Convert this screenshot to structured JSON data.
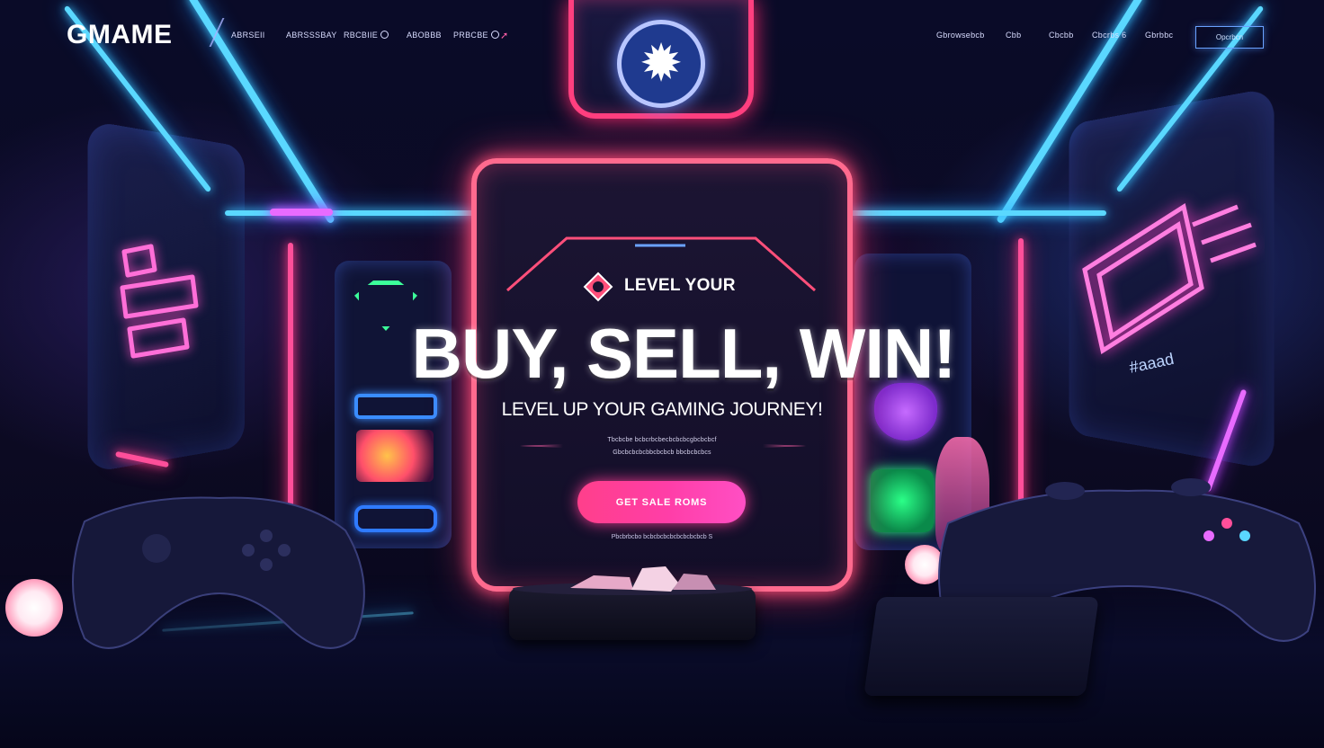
{
  "header": {
    "logo": "GMAME",
    "nav_left": [
      {
        "label": "ABRSEII",
        "icon": ""
      },
      {
        "label": "ABRSSSBAY",
        "icon": ""
      },
      {
        "label": "RBCBIIE",
        "icon": "circle-icon"
      },
      {
        "label": "ABOBBB",
        "icon": ""
      },
      {
        "label": "PRBCBE",
        "icon": "circle-icon"
      }
    ],
    "nav_right": [
      {
        "label": "Gbrowsebcb"
      },
      {
        "label": "Cbb"
      },
      {
        "label": "Cbcbb"
      },
      {
        "label": "Cbcrbs 6"
      },
      {
        "label": "Gbrbbc"
      }
    ],
    "cta_label": "Opcrbcn"
  },
  "hero": {
    "eyebrow": "LEVEL YOUR",
    "headline": "BUY, SELL, WIN!",
    "subhead": "LEVEL UP YOUR GAMING JOURNEY!",
    "desc_line_1": "Tbcbcbe bcbcrbcbecbcbcbcgbcbcbcf",
    "desc_line_2": "Gbcbcbcbcbbcbcbcb bbcbcbcbcs",
    "cta_label": "GET SALE ROMS",
    "footnote": "Pbcbrbcbo bcbcbcbcbcbcbcbcbcb S"
  },
  "colors": {
    "neon_pink": "#ff4f9a",
    "neon_cyan": "#5ad8ff",
    "neon_magenta": "#e86bff",
    "cta_gradient_start": "#ff3f8b",
    "cta_gradient_end": "#ff4fc4",
    "background": "#07061a"
  }
}
